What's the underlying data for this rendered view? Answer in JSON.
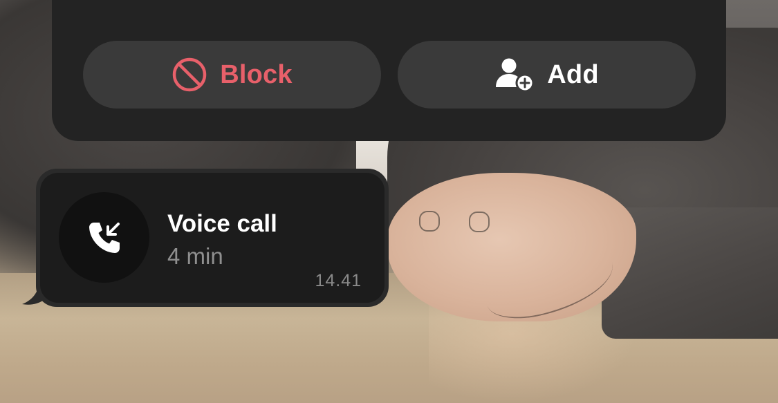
{
  "actions": {
    "block_label": "Block",
    "add_label": "Add"
  },
  "call": {
    "title": "Voice call",
    "duration": "4 min",
    "time": "14.41",
    "direction_icon": "incoming-call-icon"
  },
  "colors": {
    "card_bg": "#232323",
    "button_bg": "#3a3a3a",
    "block_accent": "#e8606a",
    "add_text": "#ffffff",
    "bubble_bg": "#1c1c1c",
    "muted_text": "#8f8f8f"
  }
}
